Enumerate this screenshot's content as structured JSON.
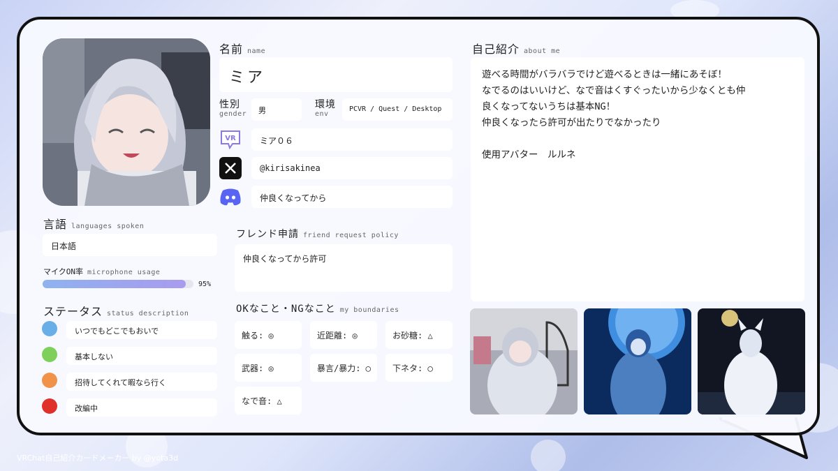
{
  "name": {
    "heading": "名前",
    "heading_sub": "name",
    "value": "ミア"
  },
  "gender": {
    "label": "性別",
    "sub": "gender",
    "value": "男"
  },
  "env": {
    "label": "環境",
    "sub": "env",
    "value": "PCVR / Quest / Desktop"
  },
  "social": [
    {
      "icon": "vrchat-icon",
      "value": "ミア０６"
    },
    {
      "icon": "x-icon",
      "value": "@kirisakinea"
    },
    {
      "icon": "discord-icon",
      "value": "仲良くなってから"
    }
  ],
  "languages": {
    "heading": "言語",
    "sub": "languages spoken",
    "value": "日本語"
  },
  "mic": {
    "heading": "マイクON率",
    "sub": "microphone usage",
    "percent_label": "95%",
    "percent": 95
  },
  "status": {
    "heading": "ステータス",
    "sub": "status description",
    "items": [
      {
        "color": "#6aaee8",
        "label": "いつでもどこでもおいで"
      },
      {
        "color": "#7fd05a",
        "label": "基本しない"
      },
      {
        "color": "#f0924a",
        "label": "招待してくれて暇なら行く"
      },
      {
        "color": "#e0302a",
        "label": "改編中"
      }
    ]
  },
  "friend": {
    "heading": "フレンド申請",
    "sub": "friend request policy",
    "value": "仲良くなってから許可"
  },
  "boundaries": {
    "heading": "OKなこと・NGなこと",
    "sub": "my boundaries",
    "items": [
      "触る: ◎",
      "近距離: ◎",
      "お砂糖: △",
      "武器: ◎",
      "暴言/暴力: ◯",
      "下ネタ: ◯",
      "なで音: △"
    ]
  },
  "about": {
    "heading": "自己紹介",
    "sub": "about me",
    "lines": [
      "遊べる時間がバラバラでけど遊べるときは一緒にあそぼ！",
      "なでるのはいいけど、なで音はくすぐったいから少なくとも仲",
      "良くなってないうちは基本NG！",
      "仲良くなったら許可が出たりでなかったり",
      "",
      "使用アバター　ルルネ"
    ]
  },
  "colors": {
    "mic_bar": "#9aa4ef",
    "accent": "#111111"
  },
  "credit": "VRChat自己紹介カードメーカー by @yota3d"
}
